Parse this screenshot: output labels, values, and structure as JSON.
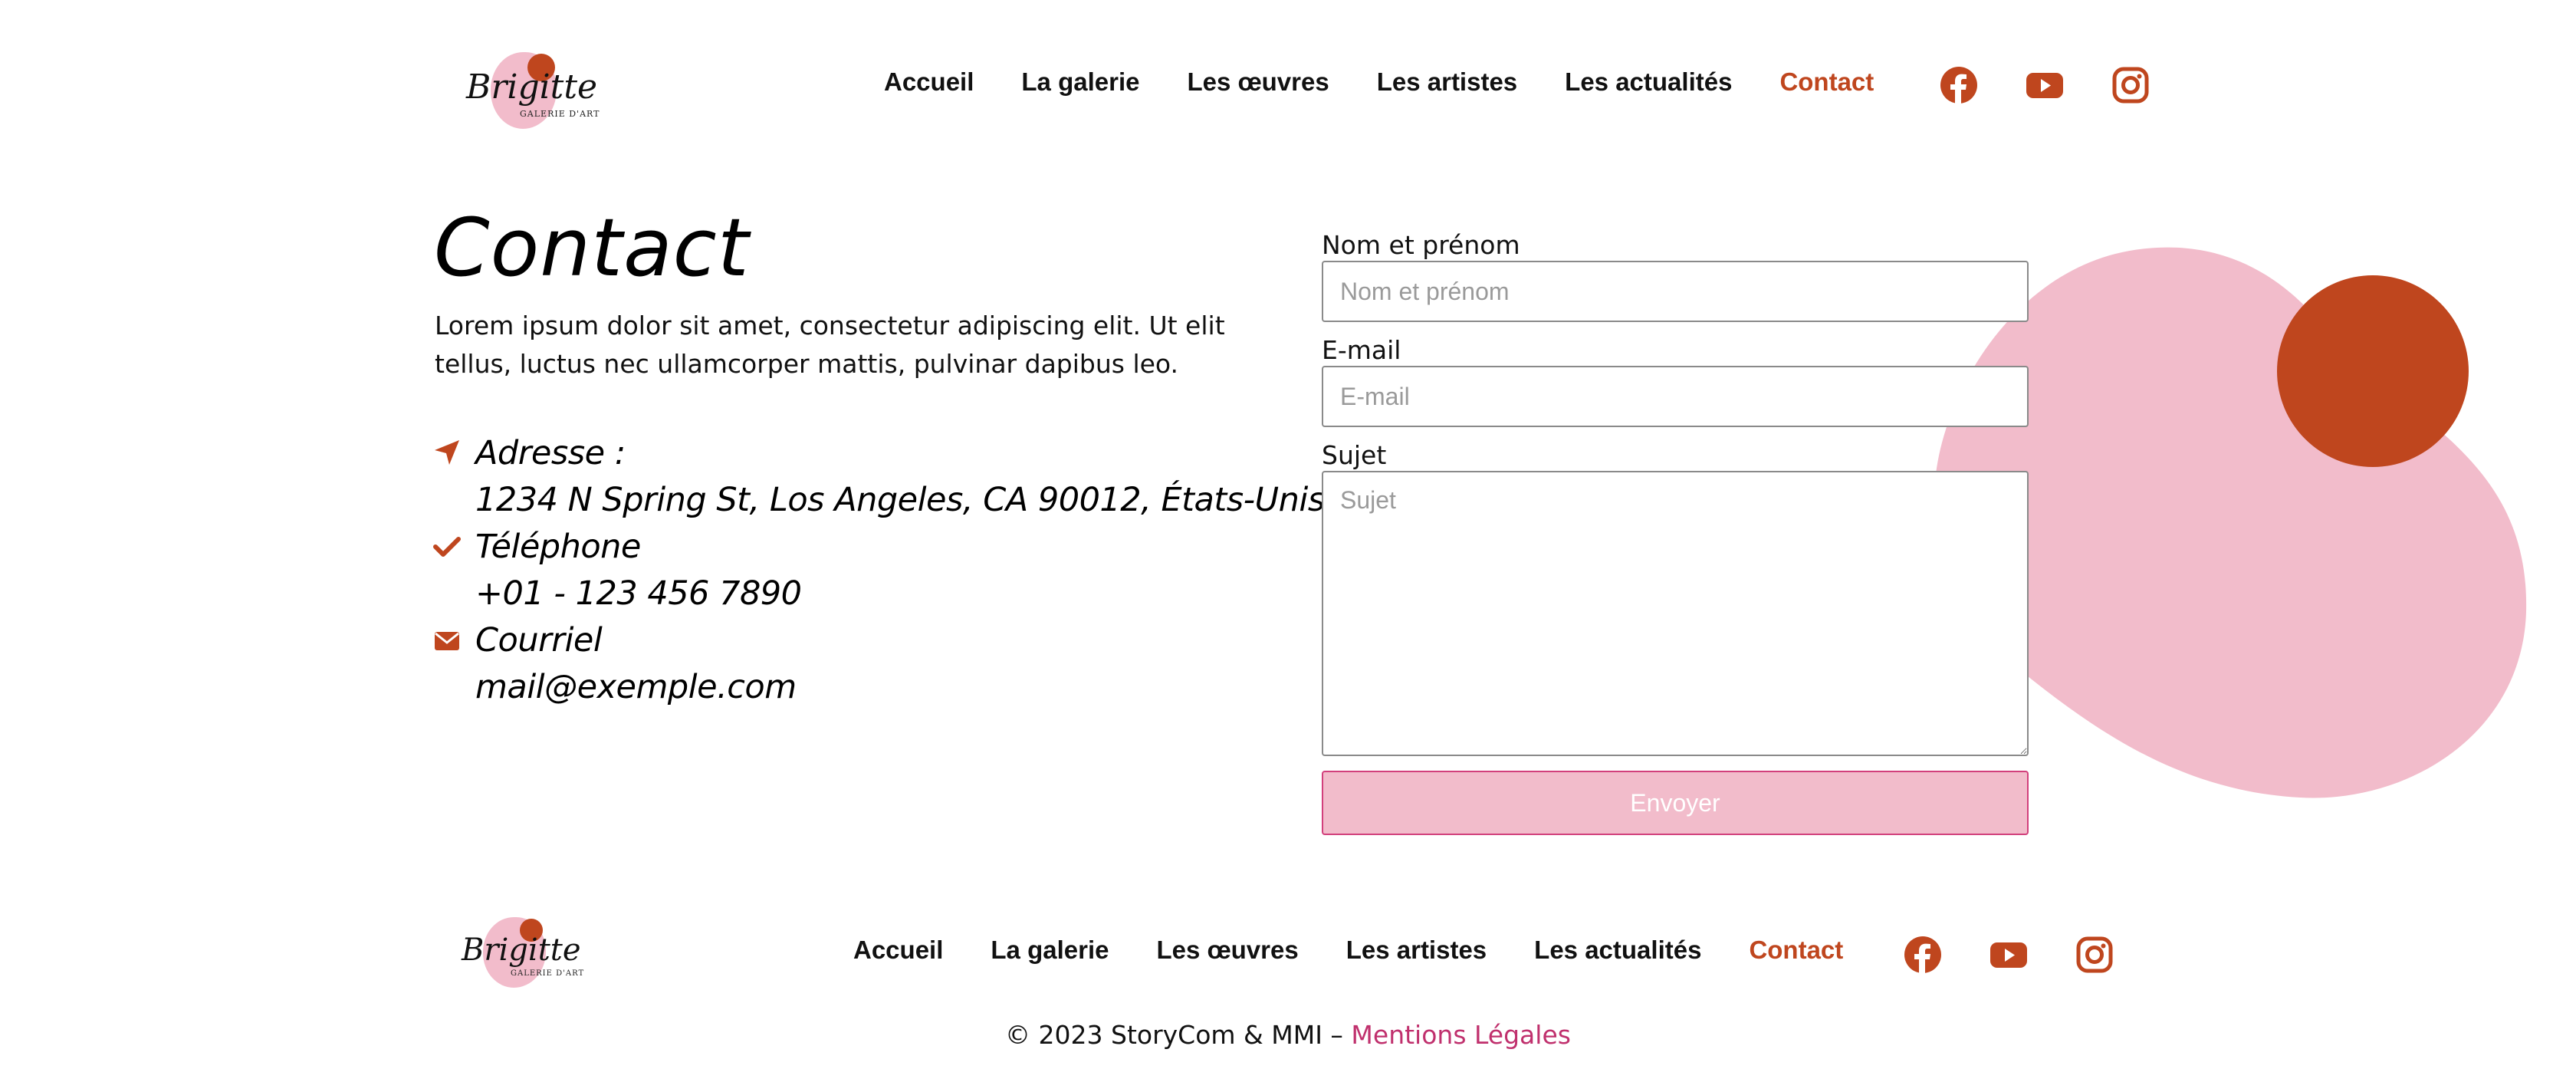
{
  "colors": {
    "accent": "#bf461e",
    "pink": "#f2bccb",
    "link_pink": "#c0306d",
    "button_border": "#d2407c"
  },
  "logo": {
    "wordmark": "Brigitte",
    "tagline": "GALERIE D'ART"
  },
  "nav": {
    "items": [
      {
        "label": "Accueil",
        "active": false
      },
      {
        "label": "La galerie",
        "active": false
      },
      {
        "label": "Les œuvres",
        "active": false
      },
      {
        "label": "Les artistes",
        "active": false
      },
      {
        "label": "Les actualités",
        "active": false
      },
      {
        "label": "Contact",
        "active": true
      }
    ]
  },
  "social": [
    "facebook-icon",
    "youtube-icon",
    "instagram-icon"
  ],
  "page": {
    "title": "Contact",
    "intro": "Lorem ipsum dolor sit amet, consectetur adipiscing elit. Ut elit tellus, luctus nec ullamcorper mattis, pulvinar dapibus leo."
  },
  "contact_info": {
    "address_label": "Adresse :",
    "address_value": "1234 N Spring St, Los Angeles, CA 90012, États-Unis",
    "phone_label": "Téléphone",
    "phone_value": "+01 - 123 456 7890",
    "email_label": "Courriel",
    "email_value": "mail@exemple.com"
  },
  "form": {
    "name_label": "Nom et prénom",
    "name_placeholder": "Nom et prénom",
    "name_value": "",
    "email_label": "E-mail",
    "email_placeholder": "E-mail",
    "email_value": "",
    "subject_label": "Sujet",
    "subject_placeholder": "Sujet",
    "subject_value": "",
    "submit_label": "Envoyer"
  },
  "footer": {
    "copyright": "© 2023 StoryCom & MMI – ",
    "legal_link": "Mentions Légales"
  }
}
